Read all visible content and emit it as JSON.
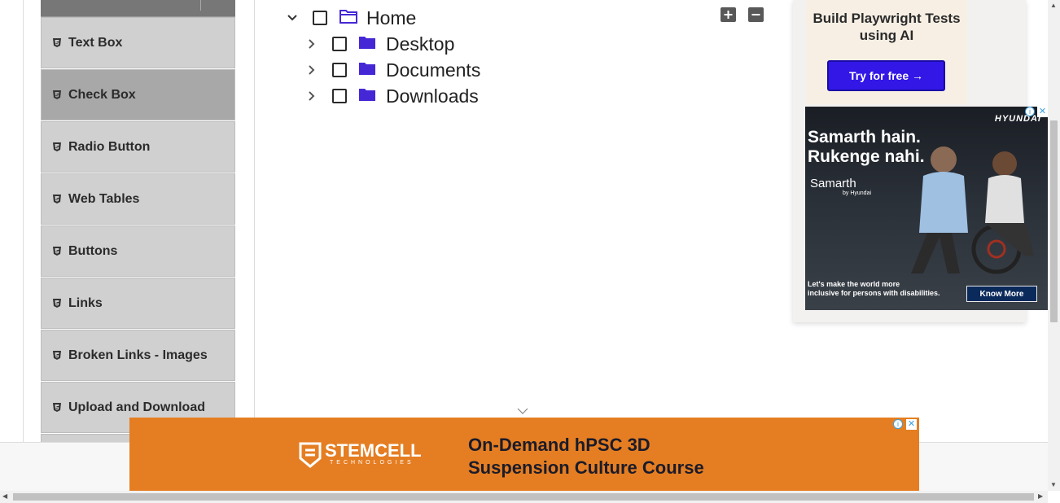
{
  "sidebar": {
    "items": [
      {
        "label": "Text Box"
      },
      {
        "label": "Check Box"
      },
      {
        "label": "Radio Button"
      },
      {
        "label": "Web Tables"
      },
      {
        "label": "Buttons"
      },
      {
        "label": "Links"
      },
      {
        "label": "Broken Links - Images"
      },
      {
        "label": "Upload and Download"
      }
    ],
    "active_index": 1
  },
  "tree": {
    "root": {
      "label": "Home",
      "expanded": true,
      "checked": false
    },
    "children": [
      {
        "label": "Desktop",
        "expanded": false,
        "checked": false
      },
      {
        "label": "Documents",
        "expanded": false,
        "checked": false
      },
      {
        "label": "Downloads",
        "expanded": false,
        "checked": false
      }
    ],
    "expand_all_icon": "plus-square-icon",
    "collapse_all_icon": "minus-square-icon",
    "folder_color": "#4527d6"
  },
  "ads": {
    "playwright": {
      "title": "Build Playwright Tests using AI",
      "button": "Try for free →",
      "button_color": "#3217e6"
    },
    "hyundai": {
      "brand": "HYUNDAI",
      "headline_1": "Samarth hain.",
      "headline_2": "Rukenge nahi.",
      "logo": "Samarth",
      "logo_sub": "by Hyundai",
      "footer_1": "Let's make the world more",
      "footer_2": "inclusive for persons with disabilities.",
      "button": "Know More"
    },
    "stemcell": {
      "logo": "STEMCELL",
      "logo_sub": "TECHNOLOGIES",
      "line_1": "On-Demand hPSC 3D",
      "line_2": "Suspension Culture Course",
      "background": "#e57e22"
    }
  }
}
